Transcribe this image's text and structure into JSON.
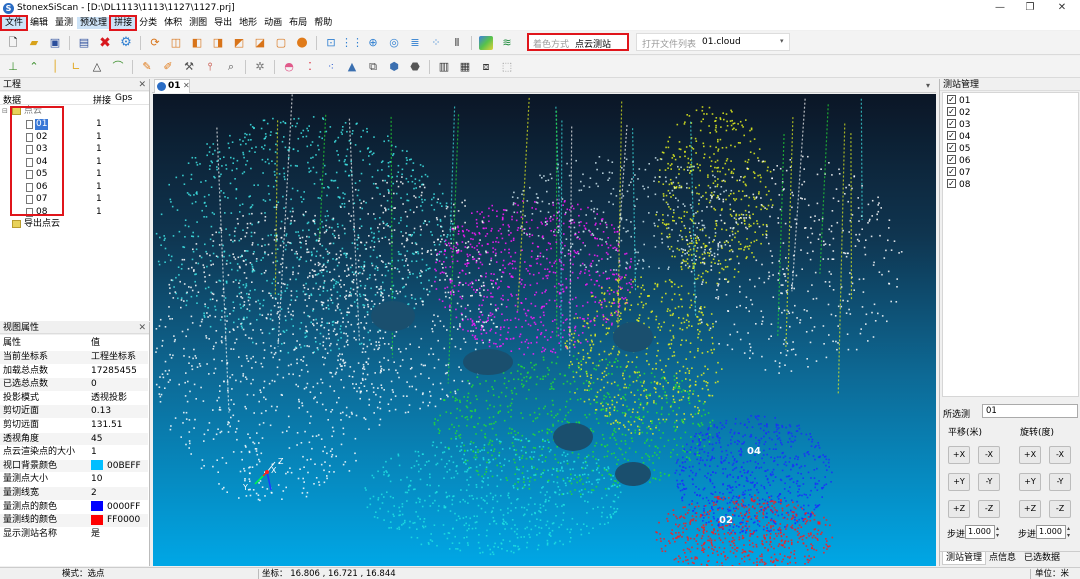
{
  "window": {
    "title": "StonexSiScan - [D:\\DL1113\\1113\\1127\\1127.prj]",
    "controls": [
      "—",
      "❐",
      "✕"
    ]
  },
  "menu": [
    "文件",
    "编辑",
    "量测",
    "预处理",
    "拼接",
    "分类",
    "体积",
    "测图",
    "导出",
    "地形",
    "动画",
    "布局",
    "帮助"
  ],
  "toolbar": {
    "color_mode_label": "着色方式",
    "color_mode_value": "点云测站",
    "open_files_label": "打开文件列表",
    "open_files_value": "01.cloud"
  },
  "view_tab": "01",
  "project_panel": {
    "title": "工程",
    "columns": [
      "数据",
      "拼接",
      "Gps"
    ],
    "root": "点云",
    "stations": [
      {
        "name": "01",
        "stitch": "1"
      },
      {
        "name": "02",
        "stitch": "1"
      },
      {
        "name": "03",
        "stitch": "1"
      },
      {
        "name": "04",
        "stitch": "1"
      },
      {
        "name": "05",
        "stitch": "1"
      },
      {
        "name": "06",
        "stitch": "1"
      },
      {
        "name": "07",
        "stitch": "1"
      },
      {
        "name": "08",
        "stitch": "1"
      }
    ],
    "export_node": "导出点云"
  },
  "view_props": {
    "title": "视图属性",
    "columns": [
      "属性",
      "值"
    ],
    "rows": [
      {
        "k": "当前坐标系",
        "v": "工程坐标系"
      },
      {
        "k": "加载总点数",
        "v": "17285455"
      },
      {
        "k": "已选总点数",
        "v": "0"
      },
      {
        "k": "投影模式",
        "v": "透视投影"
      },
      {
        "k": "剪切近面",
        "v": "0.13"
      },
      {
        "k": "剪切远面",
        "v": "131.51"
      },
      {
        "k": "透视角度",
        "v": "45"
      },
      {
        "k": "点云渲染点的大小",
        "v": "1"
      },
      {
        "k": "视口背景颜色",
        "v": "00BEFF",
        "color": "#00BEFF"
      },
      {
        "k": "量测点大小",
        "v": "10"
      },
      {
        "k": "量测线宽",
        "v": "2"
      },
      {
        "k": "量测点的颜色",
        "v": "0000FF",
        "color": "#0000FF"
      },
      {
        "k": "量测线的颜色",
        "v": "FF0000",
        "color": "#FF0000"
      },
      {
        "k": "显示测站名称",
        "v": "是"
      }
    ]
  },
  "station_panel": {
    "title": "测站管理",
    "items": [
      "01",
      "02",
      "03",
      "04",
      "05",
      "06",
      "07",
      "08"
    ],
    "selected_label": "所选测",
    "selected_value": "01",
    "translate_label": "平移(米)",
    "rotate_label": "旋转(度)",
    "buttons": [
      "+X",
      "-X",
      "+Y",
      "-Y",
      "+Z",
      "-Z"
    ],
    "step_label": "步进",
    "step_value": "1.000",
    "tabs": [
      "测站管理",
      "点信息",
      "已选数据"
    ]
  },
  "viewport": {
    "labels": [
      "04",
      "02"
    ],
    "axis_labels": [
      "Z",
      "X",
      "Y"
    ]
  },
  "status": {
    "mode": "模式：选点",
    "coords": "坐标： 16.806 , 16.721 , 16.844",
    "unit": "单位：米"
  }
}
